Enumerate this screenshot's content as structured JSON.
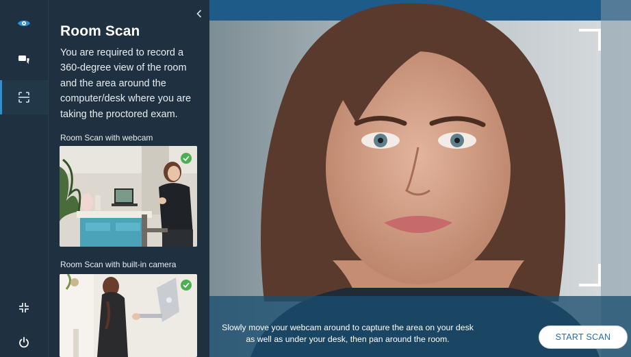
{
  "rail": {
    "items": [
      {
        "icon": "eye-icon"
      },
      {
        "icon": "chat-icon"
      },
      {
        "icon": "scan-icon",
        "active": true
      },
      {
        "icon": "exit-fullscreen-icon"
      },
      {
        "icon": "power-icon"
      }
    ]
  },
  "panel": {
    "collapse_icon": "chevron-left-icon",
    "title": "Room Scan",
    "description": "You are required to record a 360-degree view of the room and the area around the computer/desk where you are taking the proctored exam.",
    "section1_label": "Room Scan with webcam",
    "section2_label": "Room Scan with built-in camera"
  },
  "camera": {
    "caption": "Slowly move your webcam around to capture the area on your desk as well as under your desk, then pan around the room.",
    "start_button": "START SCAN"
  },
  "colors": {
    "sidebar_bg": "#1f3140",
    "accent": "#2f8fd1",
    "check_green": "#4caf50",
    "button_text": "#1f6db0"
  }
}
